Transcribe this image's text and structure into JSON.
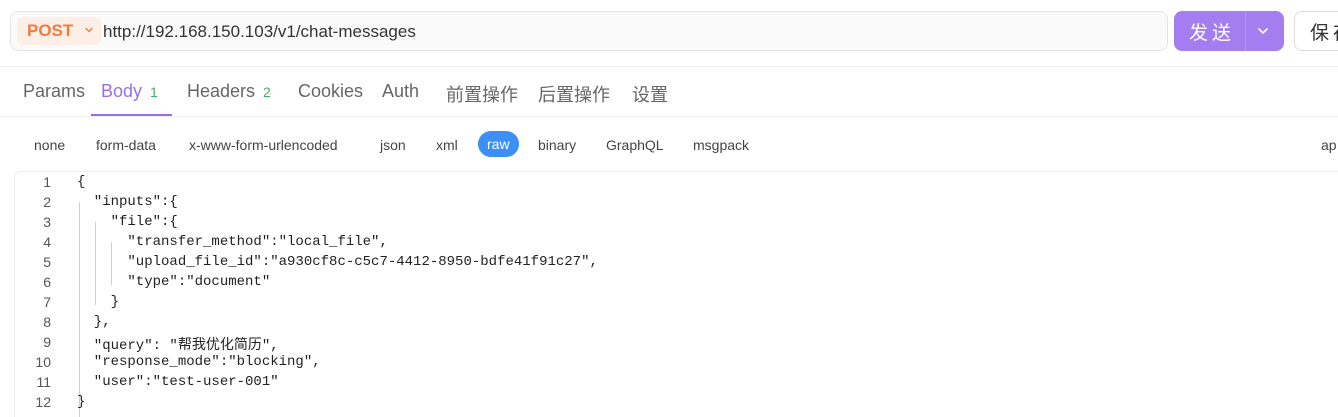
{
  "request": {
    "method": "POST",
    "url": "http://192.168.150.103/v1/chat-messages",
    "send_label": "发送",
    "save_label": "保存"
  },
  "tabs": [
    {
      "label": "Params",
      "badge": "",
      "active": false
    },
    {
      "label": "Body",
      "badge": "1",
      "active": true
    },
    {
      "label": "Headers",
      "badge": "2",
      "active": false
    },
    {
      "label": "Cookies",
      "badge": "",
      "active": false
    },
    {
      "label": "Auth",
      "badge": "",
      "active": false
    },
    {
      "label": "前置操作",
      "badge": "",
      "active": false
    },
    {
      "label": "后置操作",
      "badge": "",
      "active": false
    },
    {
      "label": "设置",
      "badge": "",
      "active": false
    }
  ],
  "body_types": [
    {
      "label": "none",
      "active": false
    },
    {
      "label": "form-data",
      "active": false
    },
    {
      "label": "x-www-form-urlencoded",
      "active": false
    },
    {
      "label": "json",
      "active": false
    },
    {
      "label": "xml",
      "active": false
    },
    {
      "label": "raw",
      "active": true
    },
    {
      "label": "binary",
      "active": false
    },
    {
      "label": "GraphQL",
      "active": false
    },
    {
      "label": "msgpack",
      "active": false
    }
  ],
  "body_type_right_label": "ap",
  "editor": {
    "lines": [
      {
        "num": "1",
        "text": "{"
      },
      {
        "num": "2",
        "text": "  \"inputs\":{"
      },
      {
        "num": "3",
        "text": "    \"file\":{"
      },
      {
        "num": "4",
        "text": "      \"transfer_method\":\"local_file\","
      },
      {
        "num": "5",
        "text": "      \"upload_file_id\":\"a930cf8c-c5c7-4412-8950-bdfe41f91c27\","
      },
      {
        "num": "6",
        "text": "      \"type\":\"document\""
      },
      {
        "num": "7",
        "text": "    }"
      },
      {
        "num": "8",
        "text": "  },"
      },
      {
        "num": "9",
        "text": "  \"query\": \"帮我优化简历\","
      },
      {
        "num": "10",
        "text": "  \"response_mode\":\"blocking\","
      },
      {
        "num": "11",
        "text": "  \"user\":\"test-user-001\""
      },
      {
        "num": "12",
        "text": "}"
      }
    ]
  },
  "colors": {
    "method": "#f07b3f",
    "accent": "#9b6ee8",
    "send_button": "#a47ef0",
    "raw_pill": "#3b8ff5",
    "badge": "#3bb25f"
  },
  "icons": {
    "method_dropdown": "chevron-down-icon",
    "send_dropdown": "chevron-down-icon"
  }
}
